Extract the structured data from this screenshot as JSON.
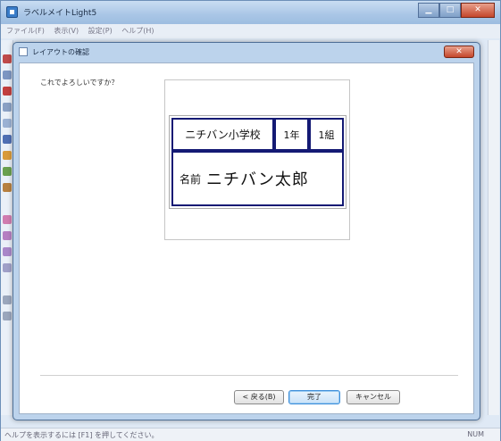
{
  "app": {
    "title": "ラベルメイトLight5",
    "menu": [
      "ファイル(F)",
      "表示(V)",
      "設定(P)",
      "ヘルプ(H)"
    ],
    "status_text": "ヘルプを表示するには [F1] を押してください。",
    "status_num": "NUM",
    "accent_color": "#141a74"
  },
  "dialog": {
    "title": "レイアウトの確認",
    "question": "これでよろしいですか？",
    "preview": {
      "school": "ニチバン小学校",
      "grade": "1年",
      "class": "1組",
      "name_label": "名前",
      "name_value": "ニチバン太郎"
    },
    "buttons": {
      "back": "< 戻る(B)",
      "finish": "完了",
      "cancel": "キャンセル"
    }
  }
}
